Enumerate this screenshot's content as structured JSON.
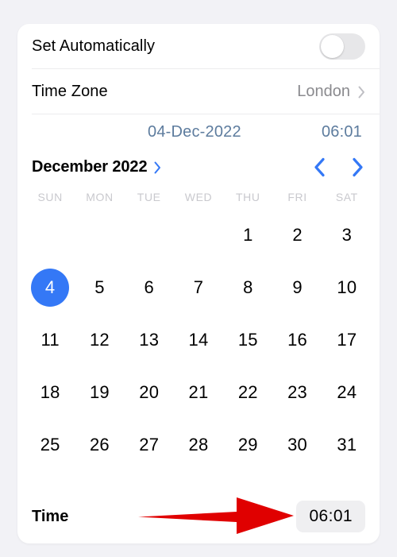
{
  "colors": {
    "page_background": "#F2F2F6",
    "card_background": "#FFFFFF",
    "accent_blue": "#3478F6",
    "summary_blue": "#5D7C9E",
    "muted_gray": "#8A8A8E",
    "weekday_gray": "#C9C9CE",
    "toggle_off_track": "#E7E7E9",
    "time_field_background": "#EFEFF1",
    "annotation_red": "#E00000"
  },
  "settings": {
    "set_automatically": {
      "label": "Set Automatically",
      "toggle_state": "off",
      "icon": "toggle-switch-icon"
    },
    "time_zone": {
      "label": "Time Zone",
      "value": "London",
      "icon": "chevron-right-icon"
    }
  },
  "summary": {
    "date": "04-Dec-2022",
    "time": "06:01"
  },
  "calendar": {
    "month_title": "December 2022",
    "month_picker_icon": "chevron-right-icon",
    "prev_month_icon": "chevron-left-icon",
    "next_month_icon": "chevron-right-icon",
    "weekdays": [
      "SUN",
      "MON",
      "TUE",
      "WED",
      "THU",
      "FRI",
      "SAT"
    ],
    "leading_blanks": 4,
    "days": [
      1,
      2,
      3,
      4,
      5,
      6,
      7,
      8,
      9,
      10,
      11,
      12,
      13,
      14,
      15,
      16,
      17,
      18,
      19,
      20,
      21,
      22,
      23,
      24,
      25,
      26,
      27,
      28,
      29,
      30,
      31
    ],
    "selected_day": 4
  },
  "time_footer": {
    "label": "Time",
    "value": "06:01"
  },
  "annotation": {
    "type": "arrow",
    "direction": "right",
    "icon": "red-arrow-icon",
    "points_to": "time-value-field"
  }
}
